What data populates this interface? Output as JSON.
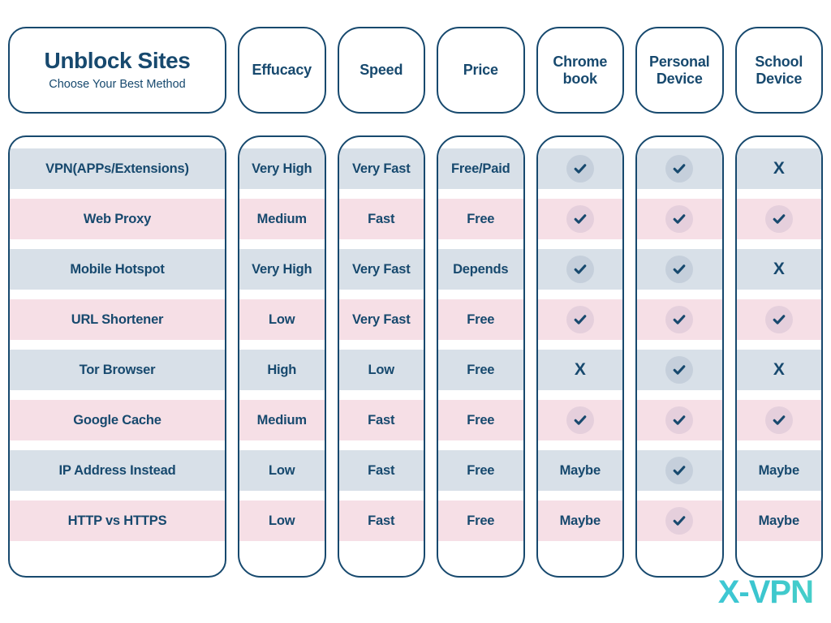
{
  "header": {
    "title": "Unblock Sites",
    "subtitle": "Choose Your Best Method",
    "columns": [
      {
        "label": "Effucacy"
      },
      {
        "label": "Speed"
      },
      {
        "label": "Price"
      },
      {
        "label": "Chrome book"
      },
      {
        "label": "Personal Device"
      },
      {
        "label": "School Device"
      }
    ]
  },
  "table": {
    "methods": [
      "VPN(APPs/Extensions)",
      "Web Proxy",
      "Mobile Hotspot",
      "URL Shortener",
      "Tor Browser",
      "Google Cache",
      "IP Address Instead",
      "HTTP vs HTTPS"
    ],
    "efficacy": [
      "Very High",
      "Medium",
      "Very High",
      "Low",
      "High",
      "Medium",
      "Low",
      "Low"
    ],
    "speed": [
      "Very Fast",
      "Fast",
      "Very Fast",
      "Very Fast",
      "Low",
      "Fast",
      "Fast",
      "Fast"
    ],
    "price": [
      "Free/Paid",
      "Free",
      "Depends",
      "Free",
      "Free",
      "Free",
      "Free",
      "Free"
    ],
    "chromebook": [
      "check",
      "check",
      "check",
      "check",
      "X",
      "check",
      "Maybe",
      "Maybe"
    ],
    "personal_device": [
      "check",
      "check",
      "check",
      "check",
      "check",
      "check",
      "check",
      "check"
    ],
    "school_device": [
      "X",
      "check",
      "X",
      "check",
      "X",
      "check",
      "Maybe",
      "Maybe"
    ]
  },
  "logo": {
    "text": "X-VPN",
    "color": "#3fc8d4"
  },
  "colors": {
    "ink": "#17496e",
    "row_blue": "#d8e0e8",
    "row_pink": "#f6dfe6",
    "badge_blue": "#c5cfdb",
    "badge_pink": "#e5cfdc"
  }
}
